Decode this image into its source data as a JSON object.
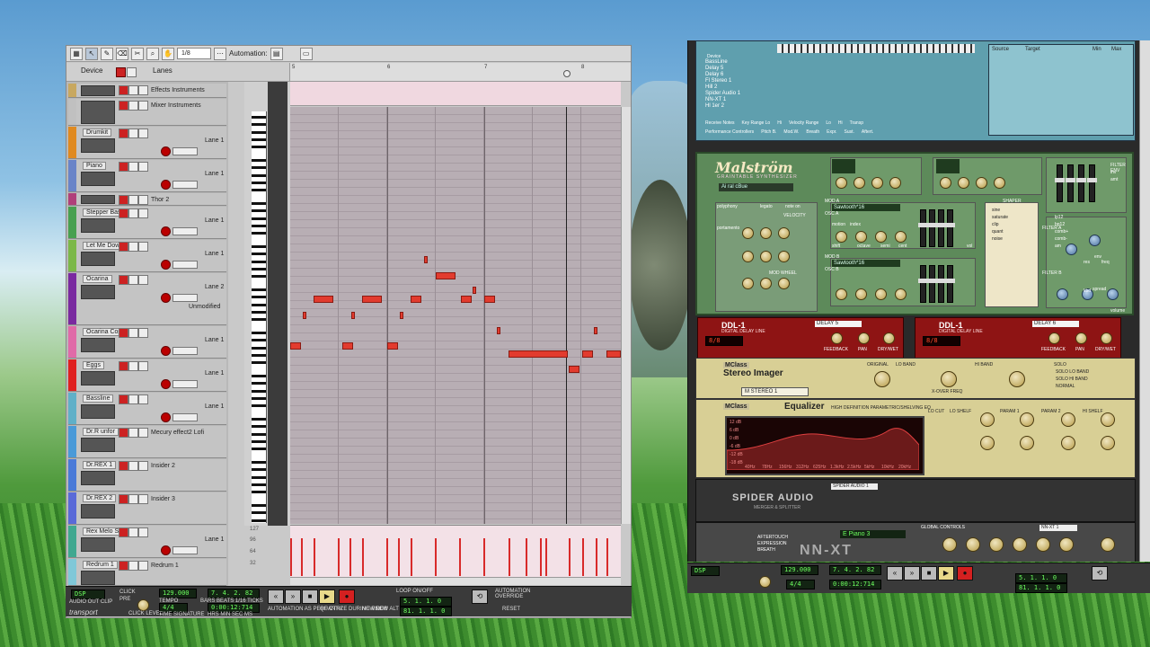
{
  "toolbar": {
    "quantize": "1/8",
    "automation_label": "Automation:"
  },
  "tabs": {
    "device": "Device",
    "lanes": "Lanes"
  },
  "ruler": [
    "5",
    "6",
    "7",
    "8"
  ],
  "tracks": [
    {
      "name": "",
      "inst": "Effects Instruments",
      "color": "#c8a860",
      "lane": ""
    },
    {
      "name": "",
      "inst": "Mixer Instruments",
      "color": "#c0c0c0",
      "lane": ""
    },
    {
      "name": "Drumkit",
      "inst": "",
      "color": "#e08a20",
      "lane": "Lane 1"
    },
    {
      "name": "Piano",
      "inst": "",
      "color": "#6a84c8",
      "lane": "Lane 1"
    },
    {
      "name": "",
      "inst": "Thor 2",
      "color": "#b0407a",
      "lane": ""
    },
    {
      "name": "Stepper Bass",
      "inst": "",
      "color": "#48a050",
      "lane": "Lane 1"
    },
    {
      "name": "Let Me Down",
      "inst": "",
      "color": "#7cb848",
      "lane": "Lane 1"
    },
    {
      "name": "Ocarina",
      "inst": "",
      "color": "#7a2aa0",
      "lane": "Lane 2",
      "extra": "Unmodified"
    },
    {
      "name": "Ocarina Copy",
      "inst": "",
      "color": "#e06aa8",
      "lane": "Lane 1"
    },
    {
      "name": "Eggs",
      "inst": "",
      "color": "#e02020",
      "lane": "Lane 1"
    },
    {
      "name": "Bassline",
      "inst": "",
      "color": "#60b0c8",
      "lane": "Lane 1"
    },
    {
      "name": "Dr.R unfor",
      "inst": "Mecury effect2 Lofi",
      "color": "#4a9ad8",
      "lane": ""
    },
    {
      "name": "Dr.REX 1",
      "inst": "Insider 2",
      "color": "#4a7ad8",
      "lane": ""
    },
    {
      "name": "Dr.REX 2",
      "inst": "Insider 3",
      "color": "#5a6ad8",
      "lane": ""
    },
    {
      "name": "Rex Melo Surround",
      "inst": "",
      "color": "#40a890",
      "lane": "Lane 1"
    },
    {
      "name": "Redrum 1",
      "inst": "Redrum 1",
      "color": "#80c8d8",
      "lane": ""
    }
  ],
  "velocity_scale": [
    "127",
    "96",
    "64",
    "32"
  ],
  "transport_left": {
    "dsp": "DSP",
    "audio_out": "AUDIO OUT CLIP",
    "brand": "transport",
    "click": "CLICK",
    "pre": "PRE",
    "click_level": "CLICK LEVEL",
    "tempo": "129.000",
    "tempo_label": "TEMPO",
    "signature": "4/4",
    "signature_label": "TIME SIGNATURE",
    "position": "7. 4. 2. 82",
    "position_label": "BARS BEATS 1/16 TICKS",
    "time": "0:00:12:714",
    "time_label": "HRS MIN SEC MS",
    "auto_label": "AUTOMATION AS PERF CTRL",
    "quantize_label": "QUANTIZE DURING REC",
    "new_dub": "NEW DUB",
    "new_alt": "NEW ALT",
    "loop_label": "LOOP ON/OFF",
    "loop_l": "5. 1. 1. 0",
    "loop_r": "81. 1. 1. 0",
    "override_label": "AUTOMATION OVERRIDE",
    "reset": "RESET"
  },
  "transport_right": {
    "tempo": "129.000",
    "signature": "4/4",
    "position": "7. 4. 2. 82",
    "time": "0:00:12:714",
    "loop_l": "5. 1. 1. 0",
    "loop_r": "81. 1. 1. 0"
  },
  "remote": {
    "list": [
      "BassLine",
      "Delay 5",
      "Delay 6",
      "Fl Stereo 1",
      "Hill 2",
      "Spider Audio 1",
      "NN-XT 1",
      "Hl 1er 2"
    ],
    "device_label": "Device",
    "cols": [
      "Source",
      "Target",
      "Min",
      "Max"
    ],
    "bottom": [
      "Receive Notes",
      "Key Range Lo",
      "Hi",
      "Velocity Range",
      "Lo",
      "Hi",
      "Transp"
    ],
    "bottom2": [
      "Performance Controllers",
      "Pitch B.",
      "Mod.W.",
      "Breath",
      "Expr.",
      "Sust.",
      "Aftert."
    ]
  },
  "malstrom": {
    "name": "Malström",
    "sub": "GRAINTABLE SYNTHESIZER",
    "patch": "Ai ral cBue",
    "osc_a": "Sawtooth*16",
    "osc_b": "Sawtooth*16",
    "labels": [
      "polyphony",
      "portamento",
      "legato",
      "note on",
      "VELOCITY",
      "MOD WHEEL",
      "MOD A",
      "MOD B",
      "OSC A",
      "OSC B",
      "FILTER ENV",
      "SHAPER",
      "FILTER A",
      "FILTER B",
      "index",
      "motion",
      "shift",
      "octave",
      "semi",
      "cent",
      "vol",
      "sine",
      "saturate",
      "clip",
      "quant",
      "noise",
      "lp12",
      "bp12",
      "comb+",
      "comb-",
      "am",
      "res",
      "freq",
      "spread",
      "volume",
      "kbd",
      "env",
      "amt",
      "inv"
    ]
  },
  "ddl": [
    {
      "title": "DDL-1",
      "sub": "DIGITAL DELAY LINE",
      "patch": "DELAY 5",
      "lcd": "8/8",
      "labels": [
        "FEEDBACK",
        "PAN",
        "DRY/WET"
      ]
    },
    {
      "title": "DDL-1",
      "sub": "DIGITAL DELAY LINE",
      "patch": "DELAY 6",
      "lcd": "8/8",
      "labels": [
        "FEEDBACK",
        "PAN",
        "DRY/WET"
      ]
    }
  ],
  "stereo_imager": {
    "brand": "MClass",
    "title": "Stereo Imager",
    "patch": "M STEREO 1",
    "labels": [
      "LO BAND",
      "HI BAND",
      "SOLO",
      "SOLO LO BAND",
      "SOLO HI BAND",
      "NORMAL",
      "X-OVER FREQ",
      "ORIGINAL"
    ]
  },
  "equalizer": {
    "brand": "MClass",
    "title": "Equalizer",
    "sub": "HIGH DEFINITION PARAMETRIC/SHELVING EQ",
    "db": [
      "12 dB",
      "6 dB",
      "0 dB",
      "-6 dB",
      "-12 dB",
      "-18 dB"
    ],
    "freqs": [
      "40Hz",
      "78Hz",
      "156Hz",
      "312Hz",
      "625Hz",
      "1.3kHz",
      "2.5kHz",
      "5kHz",
      "10kHz",
      "20kHz"
    ],
    "labels": [
      "LO CUT",
      "LO SHELF",
      "PARAM 1",
      "PARAM 2",
      "HI SHELF"
    ]
  },
  "spider": {
    "name": "SPIDER AUDIO",
    "sub": "MERGER & SPLITTER",
    "patch": "SPIDER AUDIO 1"
  },
  "nnxt": {
    "name": "NN-XT",
    "patch": "E Piano 3",
    "global": "GLOBAL CONTROLS",
    "display": "NN-XT 1",
    "labels": [
      "AFTERTOUCH",
      "EXPRESSION",
      "BREATH"
    ]
  }
}
